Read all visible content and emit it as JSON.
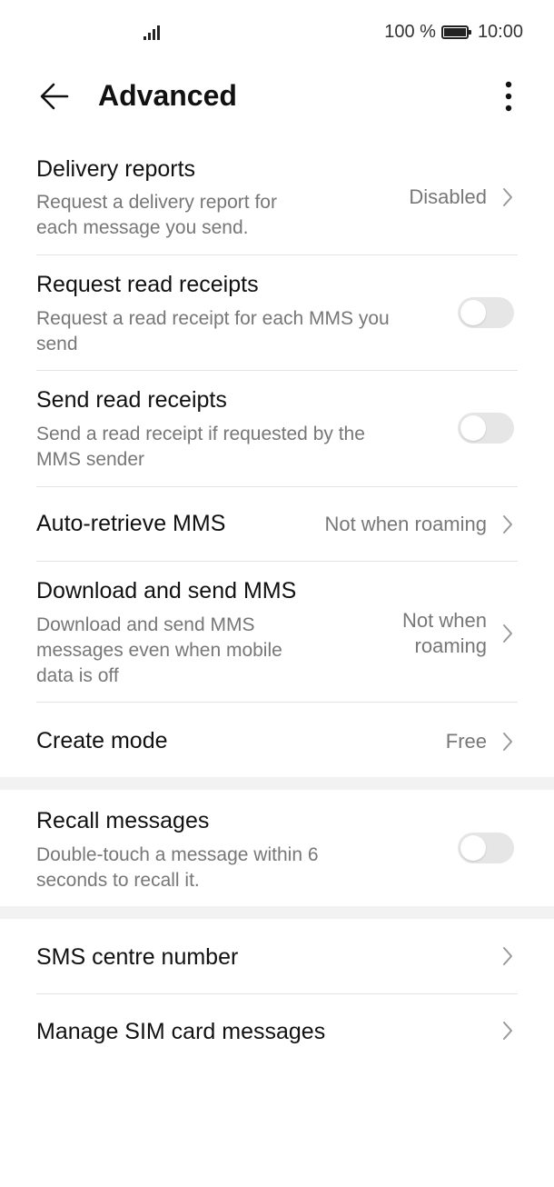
{
  "status_bar": {
    "battery_text": "100 %",
    "time": "10:00",
    "battery_level": 1.0
  },
  "header": {
    "title": "Advanced",
    "back_icon": "arrow-left-icon",
    "more_icon": "more-vertical-icon"
  },
  "settings": {
    "delivery_reports": {
      "title": "Delivery reports",
      "subtitle_line1": "Request a delivery report for",
      "subtitle_line2": "each message you send.",
      "value": "Disabled"
    },
    "request_read_receipts": {
      "title": "Request read receipts",
      "subtitle_line1": "Request a read receipt for each MMS you",
      "subtitle_line2": "send",
      "enabled": false
    },
    "send_read_receipts": {
      "title": "Send read receipts",
      "subtitle_line1": "Send a read receipt if requested by the",
      "subtitle_line2": "MMS sender",
      "enabled": false
    },
    "auto_retrieve_mms": {
      "title": "Auto-retrieve MMS",
      "value": "Not when roaming"
    },
    "download_send_mms": {
      "title": "Download and send MMS",
      "subtitle_line1": "Download and send MMS",
      "subtitle_line2": "messages even when mobile",
      "subtitle_line3": "data is off",
      "value_line1": "Not when",
      "value_line2": "roaming"
    },
    "create_mode": {
      "title": "Create mode",
      "value": "Free"
    },
    "recall_messages": {
      "title": "Recall messages",
      "subtitle_line1": "Double-touch a message within 6",
      "subtitle_line2": "seconds to recall it.",
      "enabled": false
    },
    "sms_centre_number": {
      "title": "SMS centre number"
    },
    "manage_sim_messages": {
      "title": "Manage SIM card messages"
    }
  },
  "colors": {
    "title_text": "#111111",
    "secondary_text": "#777777",
    "divider": "#e3e3e3",
    "section_band": "#f2f2f2",
    "toggle_off": "#e6e6e6"
  }
}
